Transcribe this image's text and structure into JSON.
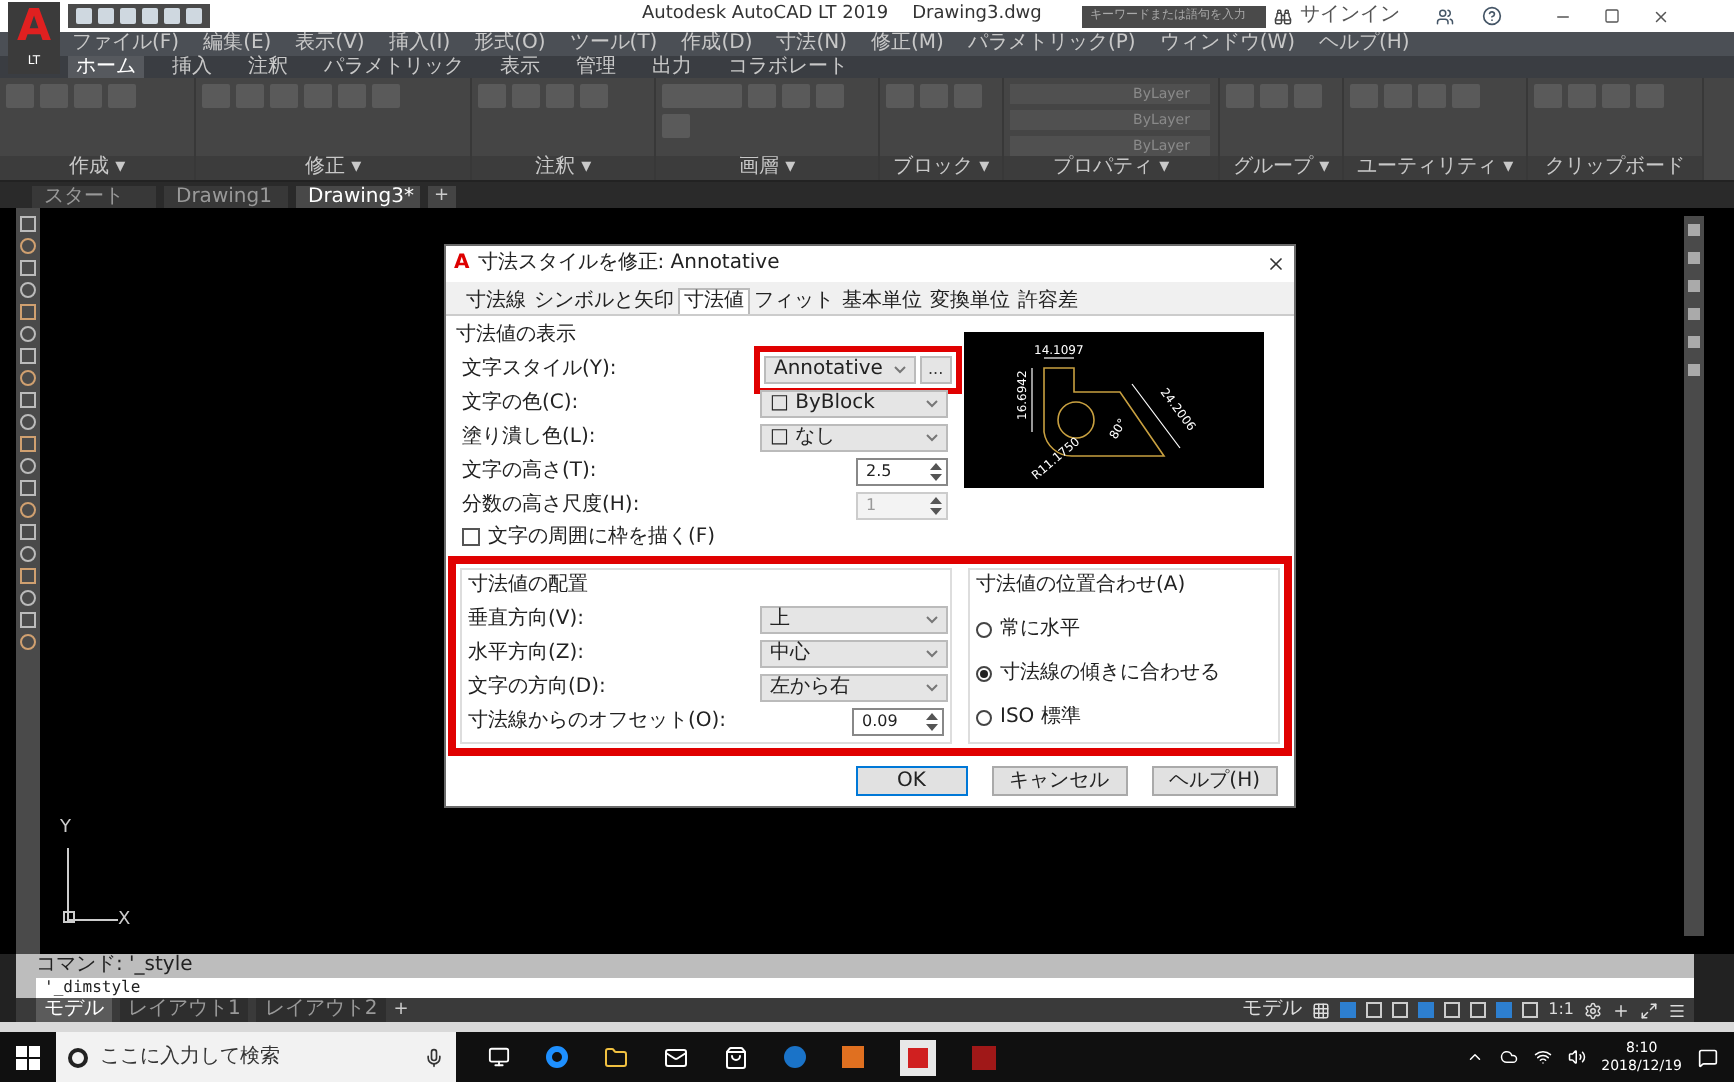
{
  "title_bar": {
    "logo": {
      "letter": "A",
      "badge": "LT"
    },
    "app_title": "Autodesk AutoCAD LT 2019",
    "document": "Drawing3.dwg",
    "search": {
      "placeholder": "キーワードまたは語句を入力"
    },
    "sign_in": "サインイン"
  },
  "menu_bar": [
    "ファイル(F)",
    "編集(E)",
    "表示(V)",
    "挿入(I)",
    "形式(O)",
    "ツール(T)",
    "作成(D)",
    "寸法(N)",
    "修正(M)",
    "パラメトリック(P)",
    "ウィンドウ(W)",
    "ヘルプ(H)"
  ],
  "ribbon": {
    "tabs": [
      {
        "label": "ホーム",
        "selected": true
      },
      {
        "label": "挿入",
        "selected": false
      },
      {
        "label": "注釈",
        "selected": false
      },
      {
        "label": "パラメトリック",
        "selected": false
      },
      {
        "label": "表示",
        "selected": false
      },
      {
        "label": "管理",
        "selected": false
      },
      {
        "label": "出力",
        "selected": false
      },
      {
        "label": "コラボレート",
        "selected": false
      }
    ],
    "panels": [
      {
        "label": "作成 ▾"
      },
      {
        "label": "修正 ▾"
      },
      {
        "label": "注釈 ▾"
      },
      {
        "label": "画層 ▾"
      },
      {
        "label": "ブロック ▾"
      },
      {
        "label": "プロパティ ▾"
      },
      {
        "label": "グループ ▾"
      },
      {
        "label": "ユーティリティ ▾"
      },
      {
        "label": "クリップボード"
      }
    ],
    "property_values": [
      "ByLayer",
      "ByLayer",
      "ByLayer"
    ]
  },
  "file_tabs": [
    {
      "label": "スタート",
      "selected": false
    },
    {
      "label": "Drawing1",
      "selected": false
    },
    {
      "label": "Drawing3*",
      "selected": true
    }
  ],
  "new_tab": "+",
  "dialog": {
    "logo_letter": "A",
    "title": "寸法スタイルを修正: Annotative",
    "tabs": [
      {
        "label": "寸法線",
        "selected": false
      },
      {
        "label": "シンボルと矢印",
        "selected": false
      },
      {
        "label": "寸法値",
        "selected": true
      },
      {
        "label": "フィット",
        "selected": false
      },
      {
        "label": "基本単位",
        "selected": false
      },
      {
        "label": "変換単位",
        "selected": false
      },
      {
        "label": "許容差",
        "selected": false
      }
    ],
    "appearance": {
      "title": "寸法値の表示",
      "rows": [
        {
          "kind": "select",
          "label": "文字スタイル(Y):",
          "value": "Annotative",
          "browse": "...",
          "highlighted": true
        },
        {
          "kind": "select",
          "label": "文字の色(C):",
          "value": "□ ByBlock",
          "highlighted": false
        },
        {
          "kind": "select",
          "label": "塗り潰し色(L):",
          "value": "□ なし",
          "highlighted": false
        },
        {
          "kind": "spin",
          "label": "文字の高さ(T):",
          "value": "2.5",
          "disabled": false
        },
        {
          "kind": "spin",
          "label": "分数の高さ尺度(H):",
          "value": "1",
          "disabled": true
        },
        {
          "kind": "check",
          "label": "文字の周囲に枠を描く(F)",
          "checked": false
        }
      ]
    },
    "preview": {
      "labels": [
        "14.1097",
        "16.6942",
        "24.2006",
        "80°",
        "R11.1750"
      ]
    },
    "placement": {
      "title": "寸法値の配置",
      "highlighted": true,
      "rows": [
        {
          "kind": "select",
          "label": "垂直方向(V):",
          "value": "上"
        },
        {
          "kind": "select",
          "label": "水平方向(Z):",
          "value": "中心"
        },
        {
          "kind": "select",
          "label": "文字の方向(D):",
          "value": "左から右"
        },
        {
          "kind": "spin",
          "label": "寸法線からのオフセット(O):",
          "value": "0.09"
        }
      ]
    },
    "alignment": {
      "title": "寸法値の位置合わせ(A)",
      "options": [
        {
          "label": "常に水平",
          "selected": false
        },
        {
          "label": "寸法線の傾きに合わせる",
          "selected": true
        },
        {
          "label": "ISO 標準",
          "selected": false
        }
      ]
    },
    "buttons": [
      "OK",
      "キャンセル",
      "ヘルプ(H)"
    ]
  },
  "ucs": {
    "x": "X",
    "y": "Y"
  },
  "command_line": {
    "history": "コマンド: '_style",
    "input": "'_dimstyle"
  },
  "layout_tabs": [
    {
      "label": "モデル",
      "selected": true
    },
    {
      "label": "レイアウト1",
      "selected": false
    },
    {
      "label": "レイアウト2",
      "selected": false
    }
  ],
  "new_layout": "+",
  "status_bar": {
    "space": "モデル",
    "scale": "1:1"
  },
  "taskbar": {
    "search": {
      "placeholder": "ここに入力して検索"
    },
    "time": "8:10",
    "date": "2018/12/19"
  }
}
